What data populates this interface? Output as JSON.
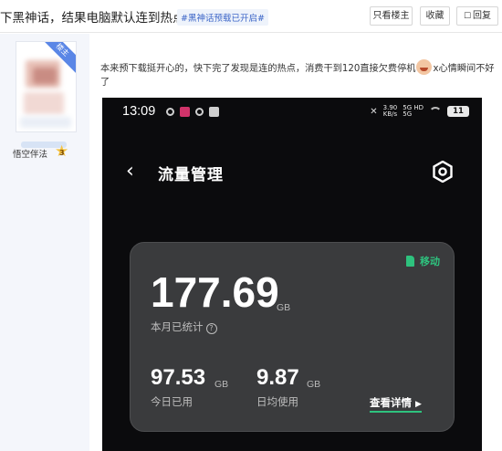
{
  "topbar": {
    "title": "下黑神话，结果电脑默认连到热点了",
    "tag": "#黑神话预载已开启#",
    "btn_op_only": "只看楼主",
    "btn_favorite": "收藏",
    "btn_reply": "回复"
  },
  "user": {
    "badge": "楼主",
    "name": "悟空伴法",
    "level": "3"
  },
  "post": {
    "text_before": "本来预下载挺开心的，快下完了发现是连的热点，消费干到120直接欠费停机",
    "text_after": "x心情瞬间不好了"
  },
  "phone": {
    "status": {
      "time": "13:09",
      "speed_value": "3.90",
      "speed_unit": "KB/s",
      "network_top": "5G HD",
      "network_bottom": "5G",
      "battery": "11"
    },
    "title": "流量管理",
    "carrier": "移动",
    "month_used": "177.69",
    "month_unit": "GB",
    "month_label": "本月已统计",
    "month_help": "?",
    "today_used": "97.53",
    "today_unit": "GB",
    "today_label": "今日已用",
    "avg_used": "9.87",
    "avg_unit": "GB",
    "avg_label": "日均使用",
    "detail_link": "查看详情"
  },
  "colors": {
    "accent_green": "#2ec27e",
    "link_blue": "#3e67c8",
    "card_bg": "#3a3b3d",
    "badge_blue": "#5a86e6"
  },
  "icons": {
    "reply": "speech-bubble-icon",
    "back": "chevron-left-icon",
    "settings": "gear-icon",
    "emoji": "laughing-face-icon",
    "level": "star-icon"
  }
}
